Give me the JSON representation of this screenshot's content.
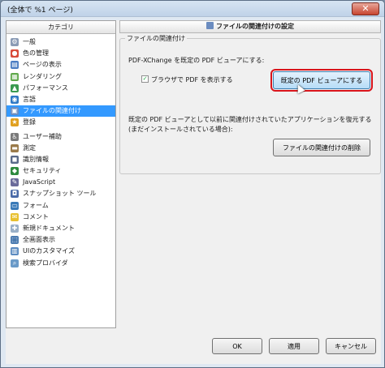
{
  "window": {
    "title": "(全体で %1 ページ)",
    "close_glyph": "✕"
  },
  "category_panel": {
    "header": "カテゴリ",
    "items": [
      {
        "label": "一般",
        "icon": "gear-icon",
        "color": "#8a9bb5",
        "glyph": "⚙"
      },
      {
        "label": "色の管理",
        "icon": "color-palette-icon",
        "color": "#d84b3a",
        "glyph": "●"
      },
      {
        "label": "ページの表示",
        "icon": "page-view-icon",
        "color": "#4a7cc2",
        "glyph": "▤"
      },
      {
        "label": "レンダリング",
        "icon": "rendering-icon",
        "color": "#5fa84a",
        "glyph": "▦"
      },
      {
        "label": "パフォーマンス",
        "icon": "performance-icon",
        "color": "#3a9a4f",
        "glyph": "▲"
      },
      {
        "label": "言語",
        "icon": "globe-icon",
        "color": "#2f78c4",
        "glyph": "◉"
      },
      {
        "label": "ファイルの関連付け",
        "icon": "file-association-icon",
        "color": "#6b8cc0",
        "glyph": "▣"
      },
      {
        "label": "登録",
        "icon": "register-icon",
        "color": "#e0a020",
        "glyph": "★"
      },
      {
        "label": "ユーザー補助",
        "icon": "accessibility-icon",
        "color": "#7a7a7a",
        "glyph": "♿"
      },
      {
        "label": "測定",
        "icon": "measure-icon",
        "color": "#9a7a4a",
        "glyph": "▬"
      },
      {
        "label": "識別情報",
        "icon": "identity-icon",
        "color": "#5a6a8a",
        "glyph": "◼"
      },
      {
        "label": "セキュリティ",
        "icon": "shield-icon",
        "color": "#2e8a3e",
        "glyph": "◆"
      },
      {
        "label": "JavaScript",
        "icon": "javascript-icon",
        "color": "#6a6a9a",
        "glyph": "✎"
      },
      {
        "label": "スナップショット ツール",
        "icon": "camera-icon",
        "color": "#4a6aa8",
        "glyph": "◘"
      },
      {
        "label": "フォーム",
        "icon": "form-icon",
        "color": "#3a7ab8",
        "glyph": "▭"
      },
      {
        "label": "コメント",
        "icon": "comment-icon",
        "color": "#e8c030",
        "glyph": "✉"
      },
      {
        "label": "新規ドキュメント",
        "icon": "new-document-icon",
        "color": "#9ab0c8",
        "glyph": "✚"
      },
      {
        "label": "全画面表示",
        "icon": "fullscreen-icon",
        "color": "#4a7ab0",
        "glyph": "⬚"
      },
      {
        "label": "UIのカスタマイズ",
        "icon": "customize-ui-icon",
        "color": "#5a8ac0",
        "glyph": "▥"
      },
      {
        "label": "検索プロバイダ",
        "icon": "search-icon",
        "color": "#6a9ac8",
        "glyph": "⌕"
      }
    ]
  },
  "settings": {
    "header": "ファイルの関連付けの設定",
    "group_title": "ファイルの関連付け",
    "default_viewer_label": "PDF-XChange を既定の PDF ビューアにする:",
    "browser_checkbox_label": "ブラウザで PDF を表示する",
    "browser_checkbox_checked": "✓",
    "make_default_button": "既定の PDF ビューアにする",
    "restore_text_line1": "既定の PDF ビューアとして以前に関連付けされていたアプリケーションを復元する",
    "restore_text_line2": "(まだインストールされている場合):",
    "remove_association_button": "ファイルの関連付けの削除"
  },
  "footer": {
    "ok": "OK",
    "apply": "適用",
    "cancel": "キャンセル"
  },
  "colors": {
    "selected": "#3399ff",
    "highlight": "#d9141b"
  }
}
